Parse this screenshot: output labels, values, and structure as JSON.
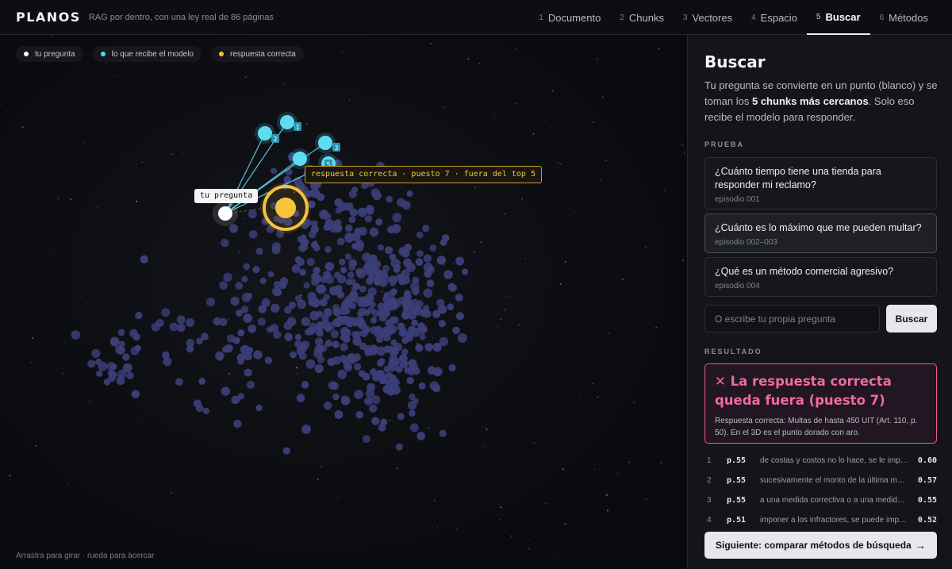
{
  "header": {
    "logo": "PLANOS",
    "tagline": "RAG por dentro, con una ley real de 86 páginas"
  },
  "tabs": [
    {
      "num": "1",
      "label": "Documento"
    },
    {
      "num": "2",
      "label": "Chunks"
    },
    {
      "num": "3",
      "label": "Vectores"
    },
    {
      "num": "4",
      "label": "Espacio"
    },
    {
      "num": "5",
      "label": "Buscar"
    },
    {
      "num": "6",
      "label": "Métodos"
    }
  ],
  "legend": [
    {
      "label": "tu pregunta",
      "color": "#ffffff"
    },
    {
      "label": "lo que recibe el modelo",
      "color": "#4fd8ef"
    },
    {
      "label": "respuesta correcta",
      "color": "#f2c23a"
    }
  ],
  "scene": {
    "question_label": "tu pregunta",
    "answer_label": "respuesta correcta · puesto 7 · fuera del top 5",
    "retrieved_ranks": [
      "1",
      "2",
      "3",
      "4",
      "5"
    ],
    "hint": "Arrastra para girar · rueda para acercar"
  },
  "panel": {
    "title": "Buscar",
    "desc_pre": "Tu pregunta se convierte en un punto (blanco) y se toman los ",
    "desc_bold": "5 chunks más cercanos",
    "desc_post": ". Solo eso recibe el modelo para responder.",
    "section_test": "PRUEBA",
    "questions": [
      {
        "text": "¿Cuánto tiempo tiene una tienda para responder mi reclamo?",
        "episode": "episodio 001"
      },
      {
        "text": "¿Cuánto es lo máximo que me pueden multar?",
        "episode": "episodio 002–003"
      },
      {
        "text": "¿Qué es un método comercial agresivo?",
        "episode": "episodio 004"
      }
    ],
    "input_placeholder": "O escribe tu propia pregunta",
    "search_button": "Buscar",
    "section_result": "RESULTADO",
    "result_headline": "✕ La respuesta correcta queda fuera (puesto 7)",
    "result_body": "Respuesta correcta: Multas de hasta 450 UIT (Art. 110, p. 50). En el 3D es el punto dorado con aro.",
    "results": [
      {
        "rank": "1",
        "page": "p.55",
        "text": "de costas y costos no lo hace, se le impone una multa",
        "score": "0.60"
      },
      {
        "rank": "2",
        "page": "p.55",
        "text": "sucesivamente el monto de la última multa impuesta",
        "score": "0.57"
      },
      {
        "rank": "3",
        "page": "p.55",
        "text": "a una medida correctiva o a una medida cautelar",
        "score": "0.55"
      },
      {
        "rank": "4",
        "page": "p.51",
        "text": "imponer a los infractores, se puede imponer",
        "score": "0.52"
      }
    ],
    "next_button": "Siguiente: comparar métodos de búsqueda",
    "next_arrow": "→"
  }
}
